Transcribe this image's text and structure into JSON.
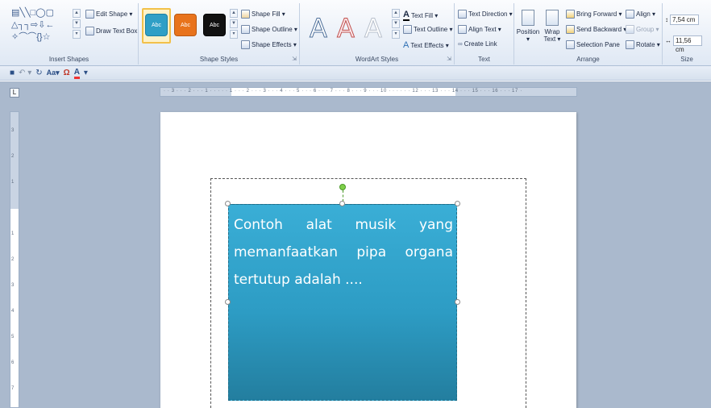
{
  "ribbon": {
    "insert_shapes": {
      "label": "Insert Shapes",
      "edit_shape": "Edit Shape ▾",
      "draw_text_box": "Draw Text Box",
      "shapes_row1": "▤╲╲□◯▢",
      "shapes_row2": "△┐┐⇨⇩←",
      "shapes_row3": "✧⌒⌒{}☆"
    },
    "shape_styles": {
      "label": "Shape Styles",
      "style1": "Abc",
      "style2": "Abc",
      "style3": "Abc",
      "shape_fill": "Shape Fill ▾",
      "shape_outline": "Shape Outline ▾",
      "shape_effects": "Shape Effects ▾",
      "colors": {
        "blue": "#2f9fc6",
        "orange": "#e8731c",
        "black": "#111111"
      }
    },
    "wordart_styles": {
      "label": "WordArt Styles",
      "letter1": "A",
      "letter2": "A",
      "letter3": "A",
      "text_fill": "Text Fill ▾",
      "text_outline": "Text Outline ▾",
      "text_effects": "Text Effects ▾"
    },
    "text": {
      "label": "Text",
      "text_direction": "Text Direction ▾",
      "align_text": "Align Text ▾",
      "create_link": "Create Link"
    },
    "arrange": {
      "label": "Arrange",
      "position": "Position",
      "position_sub": "▾",
      "wrap": "Wrap",
      "wrap_sub": "Text ▾",
      "bring_forward": "Bring Forward ▾",
      "send_backward": "Send Backward ▾",
      "selection_pane": "Selection Pane",
      "align": "Align ▾",
      "group": "Group ▾",
      "rotate": "Rotate ▾"
    },
    "size": {
      "label": "Size",
      "height": "7,54 cm",
      "width": "11,56 cm"
    }
  },
  "qat": {
    "save": "■",
    "undo": "↶ ▾",
    "redo": "↻",
    "font_case": "Aa▾",
    "symbol": "Ω",
    "font_color": "A",
    "customize": "▾"
  },
  "ruler": {
    "corner": "L",
    "h_ticks": "· · 3 · · · 2 · · · 1 · · · · · 1 · · · 2 · · · 3 · · · 4 · · · 5 · · · 6 · · · 7 · · · 8 · · · 9 · · · 10 · · · · · · 12 · · · 13 · · · 14 · · · 15 · · · 16 · · · 17 ·",
    "v_ticks": [
      "3",
      "2",
      "1",
      "1",
      "2",
      "3",
      "4",
      "5",
      "6",
      "7"
    ]
  },
  "document": {
    "shape_text": "Contoh alat musik yang memanfaatkan pipa organa tertutup adalah ...."
  }
}
